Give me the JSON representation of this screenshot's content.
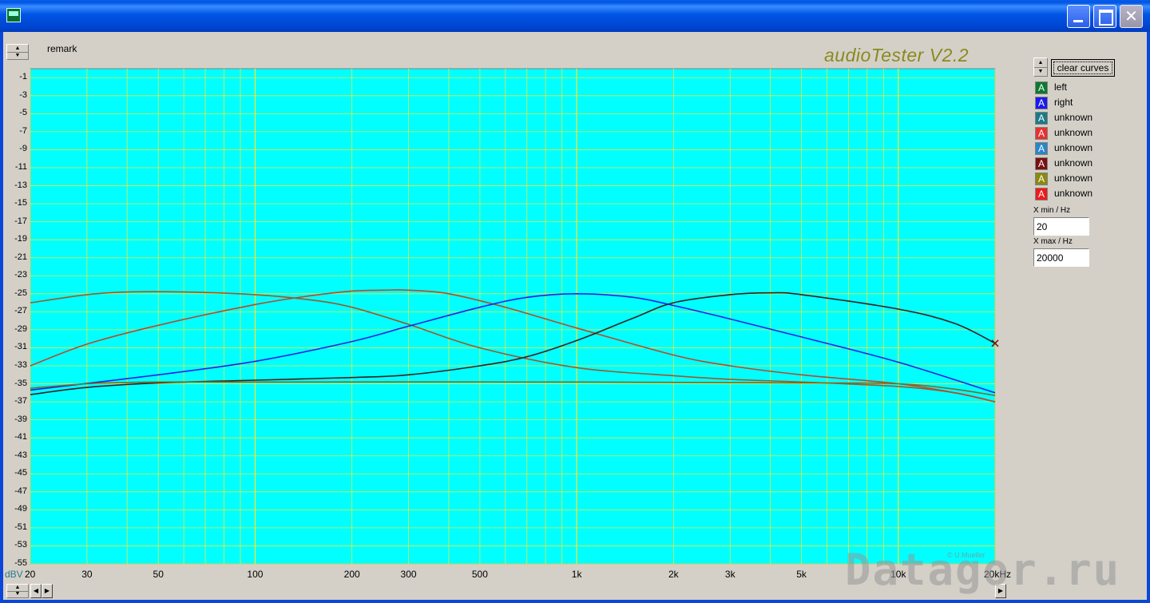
{
  "window": {
    "close_glyph": "✕"
  },
  "remark_label": "remark",
  "brand": "audioTester V2.2",
  "credit": "© U.Mueller",
  "clear_button": "clear curves",
  "legend": [
    {
      "label": "left",
      "swatch_letter": "A",
      "color": "#0b7a2e"
    },
    {
      "label": "right",
      "swatch_letter": "A",
      "color": "#1a1aee"
    },
    {
      "label": "unknown",
      "swatch_letter": "A",
      "color": "#1a7a88"
    },
    {
      "label": "unknown",
      "swatch_letter": "A",
      "color": "#e83030"
    },
    {
      "label": "unknown",
      "swatch_letter": "A",
      "color": "#2a86c8"
    },
    {
      "label": "unknown",
      "swatch_letter": "A",
      "color": "#7a1010"
    },
    {
      "label": "unknown",
      "swatch_letter": "A",
      "color": "#8a8a10"
    },
    {
      "label": "unknown",
      "swatch_letter": "A",
      "color": "#ee1a1a"
    }
  ],
  "xmin": {
    "label": "X min / Hz",
    "value": "20"
  },
  "xmax": {
    "label": "X max / Hz",
    "value": "20000"
  },
  "watermark": "Datagor.ru",
  "chart_data": {
    "type": "line",
    "x_scale": "log",
    "xlim": [
      20,
      20000
    ],
    "ylim": [
      -55,
      0
    ],
    "grid": true,
    "plot_background": "#00ffff",
    "grid_color": "#e8e840",
    "x_ticks": [
      20,
      30,
      50,
      100,
      200,
      300,
      500,
      1000,
      2000,
      3000,
      5000,
      10000,
      20000
    ],
    "x_tick_labels": [
      "20",
      "30",
      "50",
      "100",
      "200",
      "300",
      "500",
      "1k",
      "2k",
      "3k",
      "5k",
      "10k",
      "20kHz"
    ],
    "y_unit_label": "dBV",
    "y_ticks": [
      -1,
      -3,
      -5,
      -7,
      -9,
      -11,
      -13,
      -15,
      -17,
      -19,
      -21,
      -23,
      -25,
      -27,
      -29,
      -31,
      -33,
      -35,
      -37,
      -39,
      -41,
      -43,
      -45,
      -47,
      -49,
      -51,
      -53,
      -55
    ],
    "series": [
      {
        "color": "#9a5a2a",
        "x": [
          20,
          30,
          40,
          60,
          100,
          150,
          200,
          300,
          500,
          1000,
          2000,
          3000,
          5000,
          10000,
          15000,
          20000
        ],
        "y": [
          -26.0,
          -25.1,
          -24.8,
          -24.8,
          -25.1,
          -25.7,
          -26.5,
          -28.4,
          -31.0,
          -33.2,
          -34.1,
          -34.5,
          -34.8,
          -35.3,
          -36.0,
          -37.0
        ]
      },
      {
        "color": "#b84a28",
        "x": [
          20,
          30,
          50,
          100,
          150,
          200,
          250,
          300,
          400,
          600,
          1000,
          2000,
          3000,
          5000,
          10000,
          15000,
          20000
        ],
        "y": [
          -33.0,
          -30.6,
          -28.5,
          -26.2,
          -25.2,
          -24.7,
          -24.6,
          -24.6,
          -25.0,
          -26.5,
          -28.8,
          -31.8,
          -33.0,
          -34.0,
          -35.0,
          -36.0,
          -37.0
        ]
      },
      {
        "color": "#2020e0",
        "x": [
          20,
          50,
          100,
          200,
          300,
          500,
          700,
          1000,
          1500,
          2000,
          3000,
          5000,
          10000,
          20000
        ],
        "y": [
          -35.7,
          -34.0,
          -32.5,
          -30.3,
          -28.6,
          -26.5,
          -25.4,
          -25.0,
          -25.4,
          -26.3,
          -27.8,
          -29.8,
          -32.6,
          -36.0
        ]
      },
      {
        "color": "#302020",
        "x": [
          20,
          30,
          50,
          100,
          200,
          300,
          500,
          700,
          1000,
          1500,
          2000,
          3000,
          4000,
          5000,
          10000,
          15000,
          20000
        ],
        "y": [
          -36.2,
          -35.4,
          -34.9,
          -34.6,
          -34.3,
          -34.0,
          -33.0,
          -32.0,
          -30.2,
          -27.7,
          -26.0,
          -25.1,
          -24.9,
          -25.1,
          -26.7,
          -28.3,
          -30.5
        ]
      },
      {
        "color": "#707030",
        "x": [
          20,
          30,
          50,
          100,
          1000,
          5000,
          10000,
          15000,
          20000
        ],
        "y": [
          -35.5,
          -35.0,
          -34.8,
          -34.8,
          -34.8,
          -34.9,
          -35.0,
          -35.6,
          -36.3
        ]
      }
    ]
  }
}
